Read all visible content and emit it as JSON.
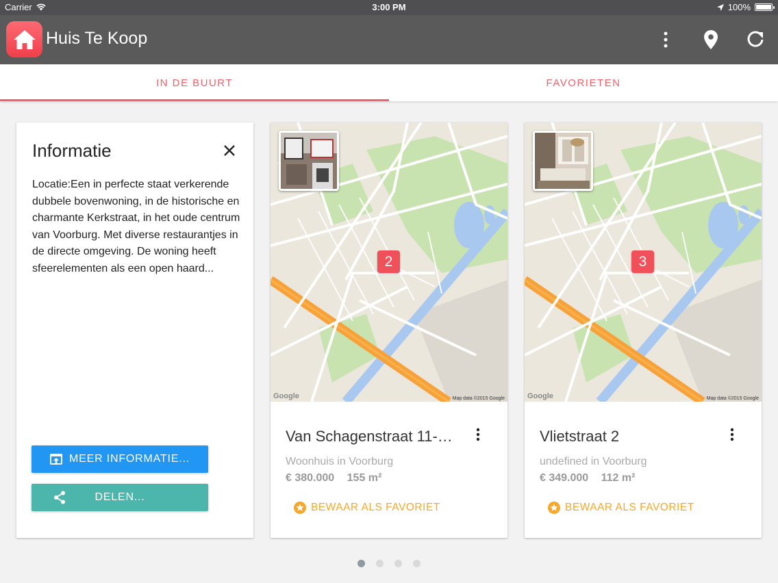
{
  "status_bar": {
    "carrier": "Carrier",
    "time": "3:00 PM",
    "battery": "100%"
  },
  "app_bar": {
    "title": "Huis Te Koop",
    "icons": [
      "more-vert-icon",
      "location-pin-icon",
      "refresh-icon"
    ]
  },
  "tabs": [
    {
      "label": "IN DE BUURT",
      "active": true
    },
    {
      "label": "FAVORIETEN",
      "active": false
    }
  ],
  "info_card": {
    "title": "Informatie",
    "description": "Locatie:Een in perfecte staat verkerende dubbele bovenwoning, in de historische en charmante Kerkstraat, in het oude centrum van Voorburg. Met diverse restaurantjes in de directe omgeving. De woning heeft sfeerelementen als een open haard...",
    "more_button": "MEER INFORMATIE...",
    "share_button": "DELEN..."
  },
  "listings": [
    {
      "marker": "2",
      "title": "Van Schagenstraat 11-…",
      "subtitle": "Woonhuis in Voorburg",
      "price": "€ 380.000",
      "area": "155 m²",
      "favorite_label": "BEWAAR ALS FAVORIET",
      "map_credit": "Map data ©2015 Google",
      "map_logo": "Google"
    },
    {
      "marker": "3",
      "title": "Vlietstraat 2",
      "subtitle": "undefined in Voorburg",
      "price": "€ 349.000",
      "area": "112 m²",
      "favorite_label": "BEWAAR ALS FAVORIET",
      "map_credit": "Map data ©2015 Google",
      "map_logo": "Google"
    }
  ],
  "pager": {
    "pages": 4,
    "current": 1
  },
  "colors": {
    "accent": "#f0616b",
    "app_bar": "#5a5a5a",
    "button_blue": "#2196f3",
    "button_teal": "#4db6ac",
    "favorite": "#f6a82a"
  }
}
